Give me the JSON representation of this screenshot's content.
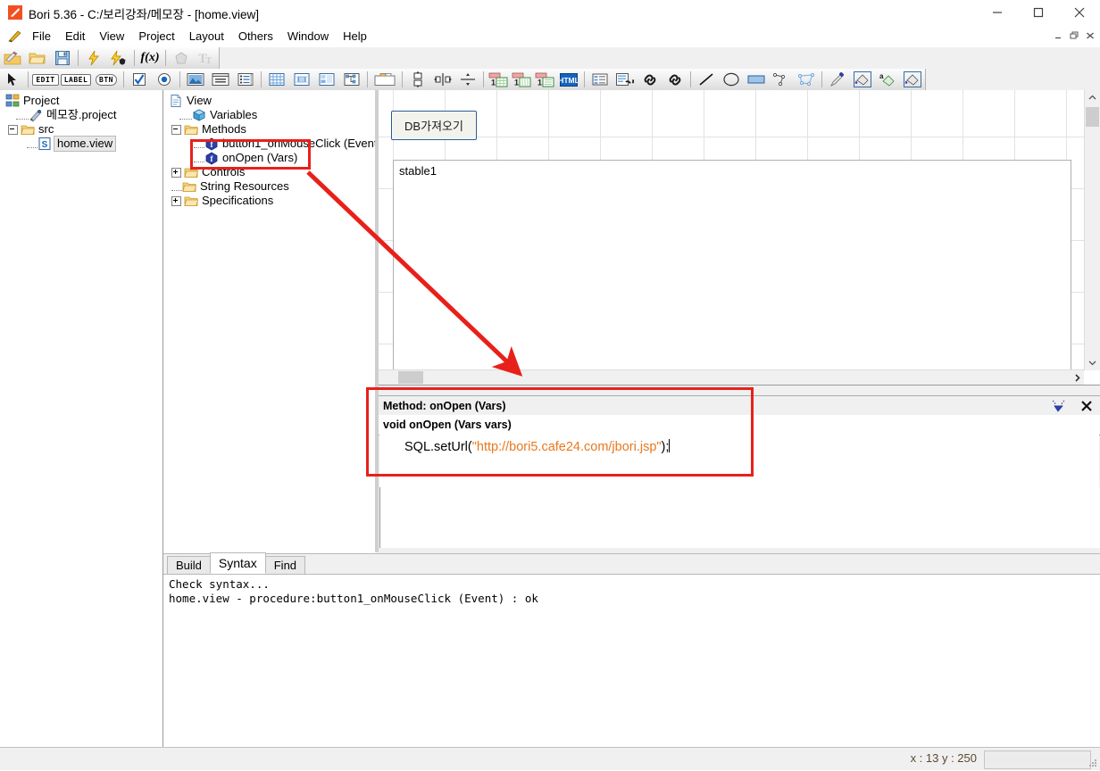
{
  "window": {
    "title": "Bori 5.36 - C:/보리강좌/메모장 - [home.view]",
    "app_icon": "feather-icon",
    "controls": {
      "minimize": "minimize-icon",
      "maximize": "maximize-icon",
      "close": "close-icon"
    },
    "mdi_controls": {
      "minimize": "mdi-minimize-icon",
      "restore": "mdi-restore-icon",
      "close": "mdi-close-icon"
    }
  },
  "menu": {
    "icon": "feather-small-icon",
    "items": [
      {
        "label": "File"
      },
      {
        "label": "Edit"
      },
      {
        "label": "View"
      },
      {
        "label": "Project"
      },
      {
        "label": "Layout"
      },
      {
        "label": "Others"
      },
      {
        "label": "Window"
      },
      {
        "label": "Help"
      }
    ]
  },
  "toolbar_row1": [
    {
      "name": "new-project-icon",
      "kind": "folder-pencil"
    },
    {
      "name": "open-folder-icon",
      "kind": "folder"
    },
    {
      "name": "save-icon",
      "kind": "floppy"
    },
    {
      "name": "separator",
      "kind": "sep"
    },
    {
      "name": "run-icon",
      "kind": "bolt"
    },
    {
      "name": "debug-icon",
      "kind": "bolt-bug"
    },
    {
      "name": "separator",
      "kind": "sep"
    },
    {
      "name": "function-icon",
      "kind": "fx"
    },
    {
      "name": "separator",
      "kind": "sep"
    },
    {
      "name": "shape-icon",
      "kind": "pentagon-gray"
    },
    {
      "name": "font-icon",
      "kind": "tt-gray"
    }
  ],
  "toolbar_row2": [
    {
      "name": "pointer-tool-icon",
      "kind": "arrow"
    },
    {
      "name": "edit-widget-icon",
      "kind": "label",
      "text": "EDIT"
    },
    {
      "name": "label-widget-icon",
      "kind": "label",
      "text": "LABEL"
    },
    {
      "name": "button-widget-icon",
      "kind": "label-round",
      "text": "BTN"
    },
    {
      "name": "checkbox-widget-icon",
      "kind": "check"
    },
    {
      "name": "radio-widget-icon",
      "kind": "radio"
    },
    {
      "name": "image-widget-icon",
      "kind": "image"
    },
    {
      "name": "panel-widget-icon",
      "kind": "panel"
    },
    {
      "name": "list-widget-icon",
      "kind": "list"
    },
    {
      "name": "grid-widget-icon",
      "kind": "grid"
    },
    {
      "name": "grid-cell-widget-icon",
      "kind": "grid2"
    },
    {
      "name": "grid-split-widget-icon",
      "kind": "grid3"
    },
    {
      "name": "tree-widget-icon",
      "kind": "tree"
    },
    {
      "name": "tab-widget-icon",
      "kind": "tabs"
    },
    {
      "name": "align-vertical-icon",
      "kind": "alignv"
    },
    {
      "name": "align-horizontal-icon",
      "kind": "alignh"
    },
    {
      "name": "align-center-icon",
      "kind": "alignc"
    },
    {
      "name": "stable-widget-icon",
      "kind": "stable1"
    },
    {
      "name": "mtable-widget-icon",
      "kind": "stable2"
    },
    {
      "name": "dtable-widget-icon",
      "kind": "stable3"
    },
    {
      "name": "html-widget-icon",
      "kind": "html"
    },
    {
      "name": "separator",
      "kind": "sep"
    },
    {
      "name": "property-list-icon",
      "kind": "proplist"
    },
    {
      "name": "link-editor-icon",
      "kind": "linkedit"
    },
    {
      "name": "link-props-icon",
      "kind": "linkprops"
    },
    {
      "name": "link-icon",
      "kind": "link"
    },
    {
      "name": "link-alt-icon",
      "kind": "link"
    },
    {
      "name": "separator",
      "kind": "sep"
    },
    {
      "name": "line-tool-icon",
      "kind": "line"
    },
    {
      "name": "ellipse-tool-icon",
      "kind": "ellipse"
    },
    {
      "name": "rect-tool-icon",
      "kind": "rect"
    },
    {
      "name": "polyline-tool-icon",
      "kind": "polyline"
    },
    {
      "name": "polygon-tool-icon",
      "kind": "polygon"
    },
    {
      "name": "separator",
      "kind": "sep"
    },
    {
      "name": "eyedropper-icon",
      "kind": "pipette"
    },
    {
      "name": "fill-color-icon",
      "kind": "bucket"
    },
    {
      "name": "text-color-icon",
      "kind": "bucket-a"
    },
    {
      "name": "bg-color-icon",
      "kind": "bucket-sel"
    }
  ],
  "project_tree": {
    "root_label": "Project",
    "root_icon": "project-icon",
    "nodes": [
      {
        "label": "메모장.project",
        "icon": "project-file-icon",
        "depth": 1,
        "expander": "none"
      },
      {
        "label": "src",
        "icon": "folder-icon",
        "depth": 1,
        "expander": "minus"
      },
      {
        "label": "home.view",
        "icon": "view-file-icon",
        "depth": 2,
        "expander": "none",
        "selected": true
      }
    ]
  },
  "view_tree": {
    "root_label": "View",
    "root_icon": "view-doc-icon",
    "nodes": [
      {
        "label": "Variables",
        "icon": "variables-icon",
        "depth": 1,
        "expander": "none"
      },
      {
        "label": "Methods",
        "icon": "folder-icon",
        "depth": 1,
        "expander": "minus"
      },
      {
        "label": "button1_onMouseClick (Event)",
        "icon": "method-icon",
        "depth": 2,
        "expander": "none"
      },
      {
        "label": "onOpen (Vars)",
        "icon": "method-icon",
        "depth": 2,
        "expander": "none",
        "highlighted": true
      },
      {
        "label": "Controls",
        "icon": "folder-icon",
        "depth": 1,
        "expander": "plus"
      },
      {
        "label": "String Resources",
        "icon": "folder-icon",
        "depth": 1,
        "expander": "none"
      },
      {
        "label": "Specifications",
        "icon": "folder-icon",
        "depth": 1,
        "expander": "plus"
      }
    ]
  },
  "canvas": {
    "button_label": "DB가져오기",
    "table_label": "stable1",
    "scrollbar_up_icon": "chevron-up-icon",
    "scrollbar_down_icon": "chevron-down-icon",
    "scrollbar_right_icon": "chevron-right-icon"
  },
  "method_editor": {
    "header_title": "Method: onOpen (Vars)",
    "check_icon": "syntax-check-icon",
    "close_icon": "close-icon",
    "signature": "void onOpen (Vars vars)",
    "code": {
      "prefix": "SQL.setUrl(",
      "string": "\"http://bori5.cafe24.com/jbori.jsp\"",
      "suffix": ");"
    }
  },
  "output": {
    "tabs": [
      {
        "label": "Build",
        "active": false
      },
      {
        "label": "Syntax",
        "active": true
      },
      {
        "label": "Find",
        "active": false
      }
    ],
    "text": "Check syntax...\nhome.view - procedure:button1_onMouseClick (Event) : ok"
  },
  "status": {
    "coords": "x : 13  y : 250"
  },
  "annotations": {
    "highlight_color": "#e8201a",
    "tree_box_label": "onOpen (Vars)",
    "method_box_label": "Method: onOpen (Vars)",
    "arrow": "red-arrow"
  }
}
